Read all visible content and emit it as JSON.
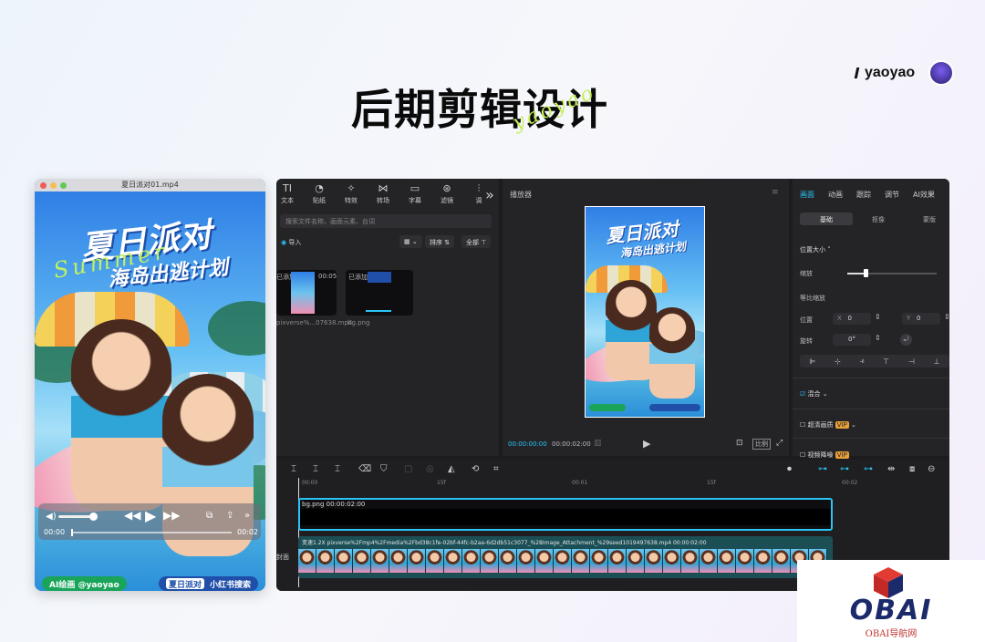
{
  "header": {
    "brand_name": "yaoyao",
    "title": "后期剪辑设计",
    "title_script": "yaoyao"
  },
  "phone": {
    "file_name": "夏日派对01.mp4",
    "poster_title": "夏日派对",
    "poster_subtitle": "海岛出逃计划",
    "poster_script": "Summer",
    "badge_left": "AI绘画 @yaoyao",
    "badge_right_a": "夏日派对",
    "badge_right_b": "小红书搜索",
    "time_start": "00:00",
    "time_end": "00:02",
    "progress_fraction": 0.0
  },
  "toolbar": {
    "items": [
      {
        "icon": "TI",
        "label": "文本"
      },
      {
        "icon": "◔",
        "label": "贴纸"
      },
      {
        "icon": "✧",
        "label": "特效"
      },
      {
        "icon": "⋈",
        "label": "转场"
      },
      {
        "icon": "▭",
        "label": "字幕"
      },
      {
        "icon": "⊛",
        "label": "滤镜"
      },
      {
        "icon": "⫶",
        "label": "调"
      }
    ],
    "more": "»"
  },
  "media": {
    "search_placeholder": "搜索文件名称、画面元素、台词",
    "import_label": "导入",
    "sort_label": "排序",
    "all_label": "全部",
    "items": [
      {
        "status": "已添加",
        "duration": "00:05",
        "name": "pixverse%...07638.mp4"
      },
      {
        "status": "已添加",
        "duration": "",
        "name": "bg.png"
      }
    ]
  },
  "player": {
    "title": "播放器",
    "time_current": "00:00:00:00",
    "time_total": "00:00:02:00",
    "ratio_label": "比例"
  },
  "inspector": {
    "tabs": [
      "画面",
      "动画",
      "跟踪",
      "调节",
      "AI效果"
    ],
    "subtabs": [
      "基础",
      "抠像",
      "蒙版"
    ],
    "section_size": "位置大小",
    "scale_label": "缩放",
    "uniform_label": "等比缩放",
    "position_label": "位置",
    "x_label": "X",
    "x_value": "0",
    "y_label": "Y",
    "y_value": "0",
    "rotate_label": "旋转",
    "rotate_value": "0°",
    "blend_label": "混合",
    "hd_label": "超清画质",
    "vip": "VIP",
    "denoise_label": "视频降噪",
    "scale_fraction": 0.2
  },
  "timeline": {
    "ticks": [
      "00:00",
      "15f",
      "00:01",
      "15f",
      "00:02"
    ],
    "track1_label": "bg.png  00:00:02:00",
    "track2_label": "变速1.2X  pixverse%2Fmp4%2Fmedia%2Fbd38c1fe-02bf-44fc-b2aa-6d2db51c3077_%28Image_Attachment_%29seed1019497638.mp4  00:00:02:00",
    "cover_label": "封面"
  },
  "watermark": {
    "logo": "OBAI",
    "sub": "OBAI导航网"
  },
  "colors": {
    "accent": "#29c5f6",
    "track": "#1b4f55",
    "bg_track": "#0e0e10"
  }
}
